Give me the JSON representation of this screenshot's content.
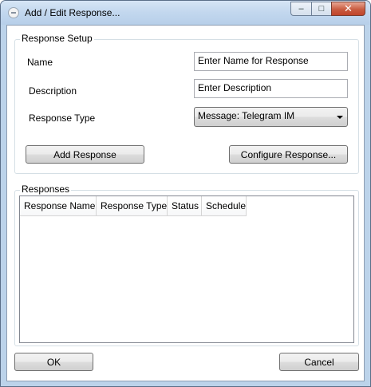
{
  "window": {
    "title": "Add / Edit Response...",
    "caption_buttons": {
      "minimize": "–",
      "maximize": "□",
      "close": "✕"
    }
  },
  "response_setup": {
    "legend": "Response Setup",
    "name_label": "Name",
    "name_value": "Enter Name for Response",
    "description_label": "Description",
    "description_value": "Enter Description",
    "type_label": "Response Type",
    "type_value": "Message: Telegram IM",
    "add_button": "Add Response",
    "configure_button": "Configure Response..."
  },
  "responses": {
    "legend": "Responses",
    "columns": [
      "Response Name",
      "Response Type",
      "Status",
      "Schedule"
    ],
    "rows": []
  },
  "footer": {
    "ok_button": "OK",
    "cancel_button": "Cancel"
  }
}
